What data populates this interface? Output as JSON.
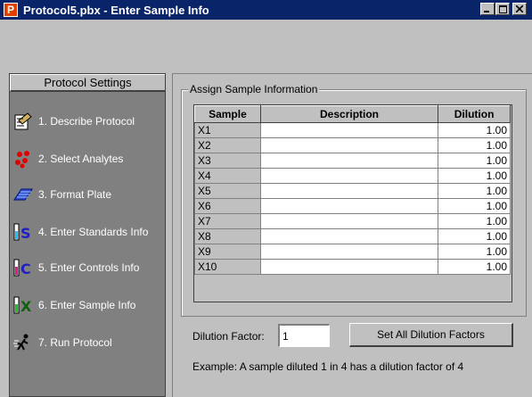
{
  "window": {
    "title": "Protocol5.pbx - Enter Sample Info",
    "app_icon_letter": "P",
    "controls": [
      "minimize",
      "maximize",
      "close"
    ]
  },
  "sidebar": {
    "header": "Protocol Settings",
    "items": [
      {
        "label": "1. Describe Protocol",
        "icon": "describe-icon"
      },
      {
        "label": "2. Select Analytes",
        "icon": "analytes-icon"
      },
      {
        "label": "3. Format Plate",
        "icon": "plate-icon"
      },
      {
        "label": "4. Enter Standards Info",
        "icon": "standards-icon"
      },
      {
        "label": "5. Enter Controls Info",
        "icon": "controls-icon"
      },
      {
        "label": "6. Enter Sample Info",
        "icon": "samples-icon"
      },
      {
        "label": "7. Run Protocol",
        "icon": "run-icon"
      }
    ]
  },
  "main": {
    "group_label": "Assign Sample Information",
    "table": {
      "headers": [
        "Sample",
        "Description",
        "Dilution"
      ],
      "rows": [
        {
          "sample": "X1",
          "description": "",
          "dilution": "1.00"
        },
        {
          "sample": "X2",
          "description": "",
          "dilution": "1.00"
        },
        {
          "sample": "X3",
          "description": "",
          "dilution": "1.00"
        },
        {
          "sample": "X4",
          "description": "",
          "dilution": "1.00"
        },
        {
          "sample": "X5",
          "description": "",
          "dilution": "1.00"
        },
        {
          "sample": "X6",
          "description": "",
          "dilution": "1.00"
        },
        {
          "sample": "X7",
          "description": "",
          "dilution": "1.00"
        },
        {
          "sample": "X8",
          "description": "",
          "dilution": "1.00"
        },
        {
          "sample": "X9",
          "description": "",
          "dilution": "1.00"
        },
        {
          "sample": "X10",
          "description": "",
          "dilution": "1.00"
        }
      ]
    },
    "dilution_factor_label": "Dilution Factor:",
    "dilution_factor_value": "1",
    "set_all_button": "Set All Dilution Factors",
    "example_text": "Example: A sample diluted 1 in 4 has a dilution factor of 4"
  }
}
